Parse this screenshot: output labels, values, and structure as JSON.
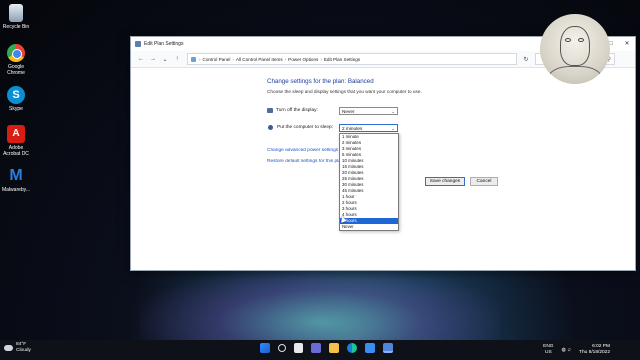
{
  "desktop": {
    "icons": [
      {
        "label": "Recycle Bin",
        "icon": "recycle-bin-icon"
      },
      {
        "label": "Google Chrome",
        "icon": "chrome-icon"
      },
      {
        "label": "Skype",
        "icon": "skype-icon"
      },
      {
        "label": "Adobe Acrobat DC",
        "icon": "acrobat-icon"
      },
      {
        "label": "Malwareby...",
        "icon": "malwarebytes-icon"
      }
    ]
  },
  "window": {
    "title": "Edit Plan Settings",
    "breadcrumb": [
      "Control Panel",
      "All Control Panel Items",
      "Power Options",
      "Edit Plan Settings"
    ],
    "search_placeholder": ""
  },
  "main": {
    "heading": "Change settings for the plan: Balanced",
    "subheading": "Choose the sleep and display settings that you want your computer to use.",
    "display_label": "Turn off the display:",
    "display_value": "Never",
    "sleep_label": "Put the computer to sleep:",
    "sleep_value": "2 minutes",
    "link_advanced": "Change advanced power settings",
    "link_restore": "Restore default settings for this plan",
    "save_button": "Save changes",
    "cancel_button": "Cancel"
  },
  "dropdown": {
    "options": [
      "1 minute",
      "2 minutes",
      "3 minutes",
      "5 minutes",
      "10 minutes",
      "15 minutes",
      "20 minutes",
      "25 minutes",
      "30 minutes",
      "45 minutes",
      "1 hour",
      "2 hours",
      "3 hours",
      "4 hours",
      "5 hours",
      "Never"
    ],
    "highlighted": "5 hours"
  },
  "taskbar": {
    "weather_temp": "84°F",
    "weather_text": "Cloudy",
    "lang_line1": "ENG",
    "lang_line2": "US",
    "time": "6:02 PM",
    "date": "Thu 8/18/2022"
  },
  "colors": {
    "heading": "#1e3f9c",
    "link": "#1a56c4",
    "selection": "#1f66d6"
  }
}
